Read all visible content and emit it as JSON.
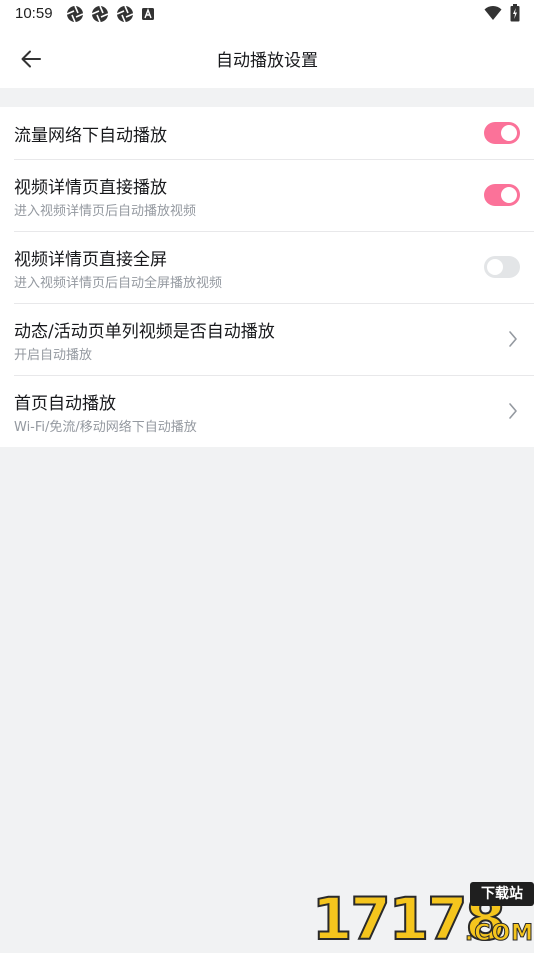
{
  "status_bar": {
    "time": "10:59",
    "left_icons": [
      "aperture-icon",
      "aperture-icon",
      "aperture-icon",
      "keyboard-a-icon"
    ],
    "right_icons": [
      "wifi-icon",
      "battery-icon"
    ]
  },
  "header": {
    "back_icon": "arrow-left-icon",
    "title": "自动播放设置"
  },
  "settings": [
    {
      "title": "流量网络下自动播放",
      "subtitle": "",
      "control": "toggle",
      "on": true
    },
    {
      "title": "视频详情页直接播放",
      "subtitle": "进入视频详情页后自动播放视频",
      "control": "toggle",
      "on": true
    },
    {
      "title": "视频详情页直接全屏",
      "subtitle": "进入视频详情页后自动全屏播放视频",
      "control": "toggle",
      "on": false
    },
    {
      "title": "动态/活动页单列视频是否自动播放",
      "subtitle": "开启自动播放",
      "control": "chevron"
    },
    {
      "title": "首页自动播放",
      "subtitle": "Wi-Fi/免流/移动网络下自动播放",
      "control": "chevron"
    }
  ],
  "colors": {
    "accent": "#fb7299",
    "toggle_off": "#e3e5e7",
    "background": "#f1f2f3"
  },
  "watermark": {
    "digits": "17178",
    "badge": "下载站",
    "suffix": ".COM"
  }
}
